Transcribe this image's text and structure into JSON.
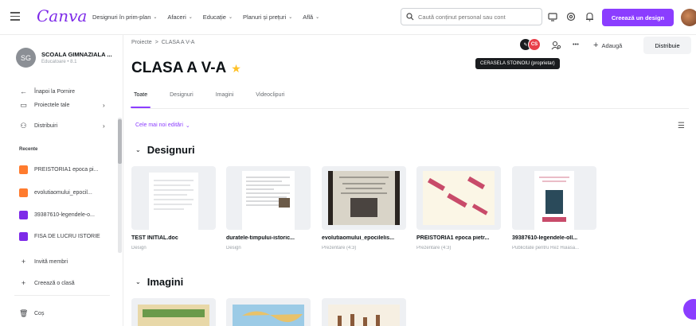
{
  "app": {
    "logo": "Canva"
  },
  "nav": [
    {
      "label": "Designuri în prim-plan"
    },
    {
      "label": "Afaceri"
    },
    {
      "label": "Educație"
    },
    {
      "label": "Planuri și prețuri"
    },
    {
      "label": "Află"
    }
  ],
  "search": {
    "placeholder": "Caută conținut personal sau cont"
  },
  "header": {
    "create_label": "Creează un design"
  },
  "sidebar": {
    "org_initials": "SG",
    "org_name": "SCOALA GIMNAZIALA ...",
    "org_sub": "Educatoare • 8.1",
    "back_label": "Înapoi la Pornire",
    "items": [
      {
        "label": "Proiectele tale"
      },
      {
        "label": "Distribuiri"
      }
    ],
    "recent_heading": "Recente",
    "recent": [
      {
        "label": "PREISTORIA1 epoca pi...",
        "color": "#ff7b2e"
      },
      {
        "label": "evolutiaomului_epocil...",
        "color": "#ff7b2e"
      },
      {
        "label": "39387610-legendele-o...",
        "color": "#7d2ae8"
      },
      {
        "label": "FISA DE LUCRU ISTORIE",
        "color": "#7d2ae8"
      }
    ],
    "invite_label": "Invită membri",
    "create_class_label": "Creează o clasă",
    "trash_label": "Coș"
  },
  "main": {
    "breadcrumb_root": "Proiecte",
    "breadcrumb_sep": ">",
    "breadcrumb_current": "CLASA A V-A",
    "title": "CLASA A V-A",
    "tabs": [
      {
        "label": "Toate"
      },
      {
        "label": "Designuri"
      },
      {
        "label": "Imagini"
      },
      {
        "label": "Videoclipuri"
      }
    ],
    "sort_label": "Cele mai noi editări",
    "sections": [
      {
        "title": "Designuri"
      },
      {
        "title": "Imagini"
      }
    ],
    "cards": [
      {
        "title": "TEST INITIAL.doc",
        "sub": "Design"
      },
      {
        "title": "duratele-timpului-istoric...",
        "sub": "Design"
      },
      {
        "title": "evolutiaomului_epocilelis...",
        "sub": "Prezentare (4:3)"
      },
      {
        "title": "PREISTORIA1 epoca pietr...",
        "sub": "Prezentare (4:3)"
      },
      {
        "title": "39387610-legendele-oll...",
        "sub": "Publicitate pentru Rez Huiasa..."
      }
    ],
    "add_label": "Adaugă",
    "share_label": "Distribuie",
    "more_label": "•••",
    "owner_initials": "CS",
    "owner_tooltip": "CERASELA STOINOIU (proprietar)"
  },
  "colors": {
    "accent": "#8b3dff",
    "star": "#ffc127"
  }
}
